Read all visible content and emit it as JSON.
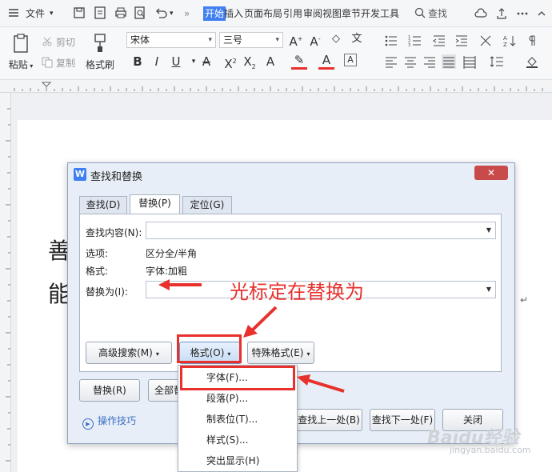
{
  "menubar": {
    "file_label": "文件",
    "tabs": [
      "开始",
      "插入",
      "页面布局",
      "引用",
      "审阅",
      "视图",
      "章节",
      "开发工具"
    ],
    "more": "»",
    "search_label": "查找"
  },
  "ribbon": {
    "paste": "粘贴",
    "cut": "剪切",
    "copy": "复制",
    "format_painter": "格式刷",
    "font_name": "宋体",
    "font_size": "三号"
  },
  "document": {
    "line1_char": "善",
    "line2_char": "能",
    "para_mark": "↵"
  },
  "dialog": {
    "logo": "W",
    "title": "查找和替换",
    "tabs": [
      "查找(D)",
      "替换(P)",
      "定位(G)"
    ],
    "find_label": "查找内容(N):",
    "options_label": "选项:",
    "options_value": "区分全/半角",
    "format_label": "格式:",
    "format_value": "字体:加粗",
    "replace_label": "替换为(I):",
    "advanced_btn": "高级搜索(M)",
    "format_btn": "格式(O)",
    "special_btn": "特殊格式(E)",
    "replace_btn": "替换(R)",
    "replace_all_btn": "全部替",
    "find_prev_btn": "查找上一处(B)",
    "find_next_btn": "查找下一处(F)",
    "close_btn": "关闭",
    "tips": "操作技巧"
  },
  "format_menu": [
    "字体(F)...",
    "段落(P)...",
    "制表位(T)...",
    "样式(S)...",
    "突出显示(H)"
  ],
  "annotation": "光标定在替换为",
  "watermark": {
    "brand": "Baidu经验",
    "url": "jingyan.baidu.com"
  },
  "colors": {
    "accent": "#3f7ff1",
    "annotation_red": "#e8302c"
  }
}
